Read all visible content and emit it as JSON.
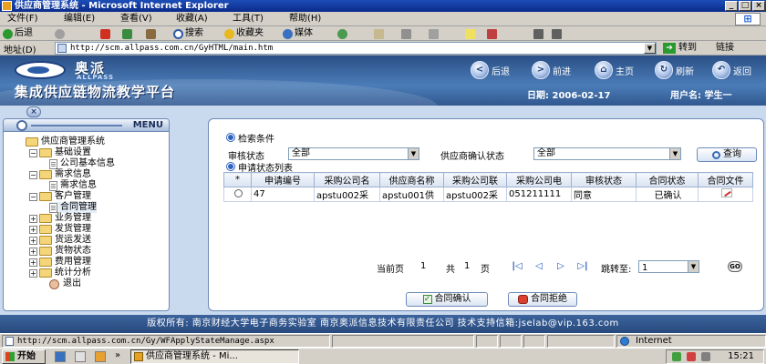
{
  "window": {
    "title": "供应商管理系统 - Microsoft Internet Explorer"
  },
  "menubar": [
    "文件(F)",
    "编辑(E)",
    "查看(V)",
    "收藏(A)",
    "工具(T)",
    "帮助(H)"
  ],
  "toolbar": {
    "back": "后退",
    "search": "搜索",
    "favorites": "收藏夹",
    "media": "媒体"
  },
  "address": {
    "label": "地址(D)",
    "url": "http://scm.allpass.com.cn/GyHTML/main.htm",
    "go": "转到",
    "links": "链接"
  },
  "banner": {
    "logo_cn": "奥派",
    "logo_en": "ALLPASS",
    "platform": "集成供应链物流教学平台",
    "nav": {
      "back": "后退",
      "forward": "前进",
      "home": "主页",
      "refresh": "刷新",
      "return": "返回"
    },
    "date": "日期:  2006-02-17",
    "user": "用户名:  学生一"
  },
  "menu": {
    "header": "MENU",
    "items": [
      {
        "label": "供应商管理系统",
        "level": 0
      },
      {
        "label": "基础设置",
        "level": 1
      },
      {
        "label": "公司基本信息",
        "level": 2
      },
      {
        "label": "需求信息",
        "level": 1
      },
      {
        "label": "需求信息",
        "level": 2
      },
      {
        "label": "客户管理",
        "level": 1
      },
      {
        "label": "合同管理",
        "level": 2
      },
      {
        "label": "业务管理",
        "level": 1
      },
      {
        "label": "发货管理",
        "level": 1
      },
      {
        "label": "货运发送",
        "level": 1
      },
      {
        "label": "货物状态",
        "level": 1
      },
      {
        "label": "费用管理",
        "level": 1
      },
      {
        "label": "统计分析",
        "level": 1
      },
      {
        "label": "退出",
        "level": 1
      }
    ]
  },
  "search": {
    "section_title": "检索条件",
    "audit_label": "审核状态",
    "audit_value": "全部",
    "confirm_label": "供应商确认状态",
    "confirm_value": "全部",
    "query_button": "查询"
  },
  "list": {
    "section_title": "申请状态列表",
    "columns": [
      "*",
      "申请编号",
      "采购公司名",
      "供应商名称",
      "采购公司联",
      "采购公司电",
      "审核状态",
      "合同状态",
      "合同文件"
    ],
    "rows": [
      {
        "id": "47",
        "buyer": "apstu002采",
        "supplier": "apstu001供",
        "contact": "apstu002采",
        "phone": "051211111",
        "audit": "同意",
        "contract": "已确认"
      }
    ]
  },
  "pager": {
    "current_label": "当前页",
    "current": "1",
    "total_label": "共",
    "total": "1",
    "unit": "页",
    "jump_label": "跳转至:",
    "jump_value": "1",
    "go": "GO"
  },
  "actions": {
    "confirm": "合同确认",
    "reject": "合同拒绝"
  },
  "footer": {
    "text": "版权所有: 南京财经大学电子商务实验室  南京奥派信息技术有限责任公司  技术支持信箱:jselab@vip.163.com"
  },
  "status": {
    "url": "http://scm.allpass.com.cn/Gy/WFApplyStateManage.aspx",
    "zone": "Internet"
  },
  "taskbar": {
    "start": "开始",
    "task": "供应商管理系统 - Mi...",
    "clock": "15:21"
  }
}
